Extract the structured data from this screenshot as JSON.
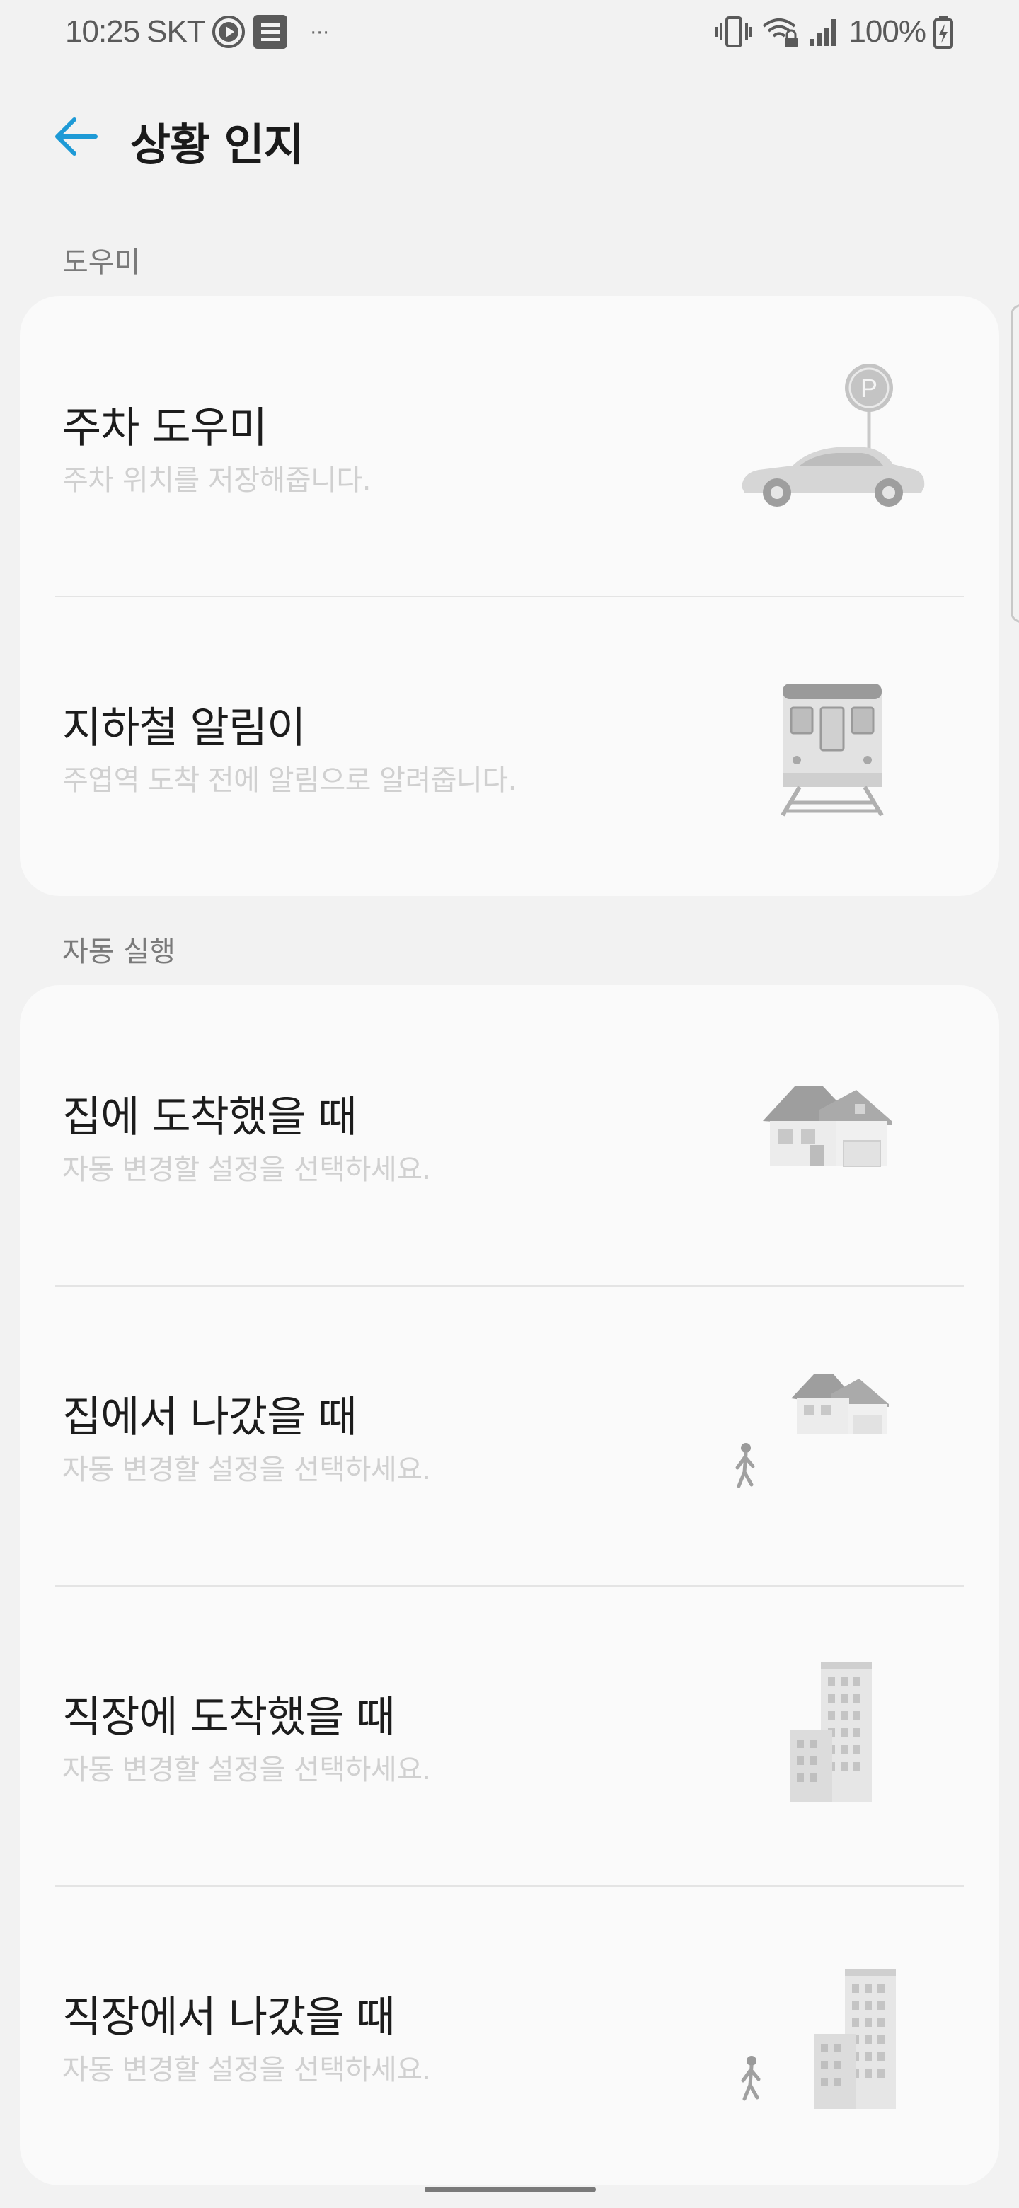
{
  "status_bar": {
    "time": "10:25",
    "carrier": "SKT",
    "more": "···",
    "battery": "100%"
  },
  "app_bar": {
    "title": "상황 인지"
  },
  "sections": [
    {
      "label": "도우미",
      "items": [
        {
          "title": "주차 도우미",
          "subtitle": "주차 위치를 저장해줍니다.",
          "illustration": "parking-car-icon"
        },
        {
          "title": "지하철 알림이",
          "subtitle": "주엽역 도착 전에 알림으로 알려줍니다.",
          "illustration": "subway-train-icon"
        }
      ]
    },
    {
      "label": "자동 실행",
      "items": [
        {
          "title": "집에 도착했을 때",
          "subtitle": "자동 변경할 설정을 선택하세요.",
          "illustration": "house-icon"
        },
        {
          "title": "집에서 나갔을 때",
          "subtitle": "자동 변경할 설정을 선택하세요.",
          "illustration": "house-walker-icon"
        },
        {
          "title": "직장에 도착했을 때",
          "subtitle": "자동 변경할 설정을 선택하세요.",
          "illustration": "office-building-icon"
        },
        {
          "title": "직장에서 나갔을 때",
          "subtitle": "자동 변경할 설정을 선택하세요.",
          "illustration": "office-walker-icon"
        }
      ]
    }
  ],
  "colors": {
    "accent": "#1e9ad6",
    "background": "#f2f2f2",
    "card": "#fafafa",
    "subtitle": "#d0d0d0"
  }
}
